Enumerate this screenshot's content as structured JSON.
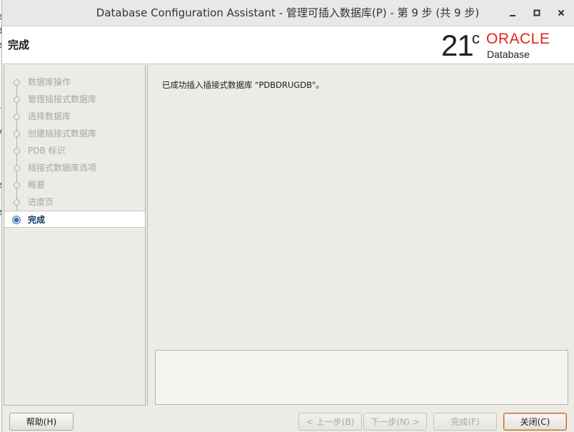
{
  "window": {
    "title": "Database Configuration Assistant - 管理可插入数据库(P) - 第 9 步 (共 9 步)",
    "controls": [
      "minimize-icon",
      "maximize-icon",
      "close-icon"
    ]
  },
  "background_fragment": [
    "e",
    "d",
    "e",
    "r",
    "y",
    "e",
    "f",
    "e"
  ],
  "header": {
    "page_title": "完成",
    "logo": {
      "version": "21",
      "version_sup": "c",
      "brand": "ORACLE",
      "product": "Database"
    }
  },
  "nav": {
    "items": [
      {
        "label": "数据库操作",
        "state": "done"
      },
      {
        "label": "管理插接式数据库",
        "state": "done"
      },
      {
        "label": "选择数据库",
        "state": "done"
      },
      {
        "label": "创建插接式数据库",
        "state": "done"
      },
      {
        "label": "PDB 标识",
        "state": "done"
      },
      {
        "label": "插接式数据库选项",
        "state": "done"
      },
      {
        "label": "概要",
        "state": "done"
      },
      {
        "label": "进度页",
        "state": "done"
      },
      {
        "label": "完成",
        "state": "active"
      }
    ]
  },
  "content": {
    "message": "已成功插入插接式数据库 \"PDBDRUGDB\"。",
    "details_text": ""
  },
  "footer": {
    "help": "帮助(H)",
    "back": "< 上一步(B)",
    "next": "下一步(N) >",
    "finish": "完成(F)",
    "close": "关闭(C)"
  },
  "colors": {
    "accent": "#10355f",
    "oracle_red": "#e2231a",
    "panel_bg": "#edebe6"
  }
}
